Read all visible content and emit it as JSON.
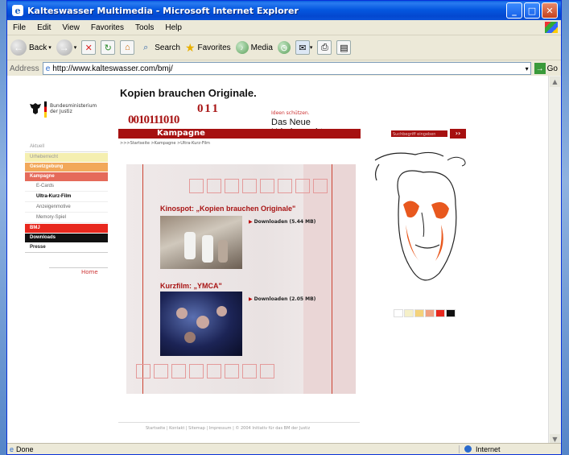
{
  "window": {
    "title": "Kalteswasser Multimedia - Microsoft Internet Explorer",
    "btn_min": "_",
    "btn_max": "□",
    "btn_close": "✕"
  },
  "menu": [
    "File",
    "Edit",
    "View",
    "Favorites",
    "Tools",
    "Help"
  ],
  "toolbar": {
    "back": "Back",
    "search": "Search",
    "favorites": "Favorites",
    "media": "Media"
  },
  "address": {
    "label": "Address",
    "url": "http://www.kalteswasser.com/bmj/",
    "go": "Go"
  },
  "site": {
    "ministry_line1": "Bundesministerium",
    "ministry_line2": "der Justiz",
    "headline": "Kopien brauchen Originale.",
    "numbers": "0 1 1\n0010111010",
    "ideen": "Ideen schützen.",
    "neue": "Das Neue Urheberrecht",
    "kampagne": "Kampagne",
    "search_placeholder": "Suchbegriff eingeben",
    "search_btn": "››",
    "breadcrumb": ">>>Startseite >Kampagne >Ultra-Kurz-Film",
    "nav": [
      {
        "label": "Aktuell",
        "cls": "aktuell"
      },
      {
        "label": "Urheberrecht",
        "cls": "urheber"
      },
      {
        "label": "Gesetzgebung",
        "cls": "gesetz"
      },
      {
        "label": "Kampagne",
        "cls": "kamp"
      },
      {
        "label": "E-Cards",
        "cls": "sub"
      },
      {
        "label": "Ultra-Kurz-Film",
        "cls": "sub act"
      },
      {
        "label": "Anzeigenmotive",
        "cls": "sub"
      },
      {
        "label": "Memory-Spiel",
        "cls": "sub"
      },
      {
        "label": "BMJ",
        "cls": "bmjn"
      },
      {
        "label": "Downloads",
        "cls": "dl"
      },
      {
        "label": "Presse",
        "cls": "presse"
      }
    ],
    "home": "Home",
    "kinospot_title": "Kinospot: „Kopien brauchen Originale\"",
    "kinospot_download": "Downloaden (5.44 MB)",
    "kurzfilm_title": "Kurzfilm: „YMCA\"",
    "kurzfilm_download": "Downloaden (2.05 MB)",
    "footer": "Startseite | Kontakt | Sitemap | Impressum | © 2004 Initiativ für das BM der Justiz",
    "swatch_colors": [
      "#ffffff",
      "#f5f0c8",
      "#f4d27a",
      "#f0a080",
      "#e8281e",
      "#111111"
    ]
  },
  "status": {
    "left": "Done",
    "zone": "Internet"
  }
}
